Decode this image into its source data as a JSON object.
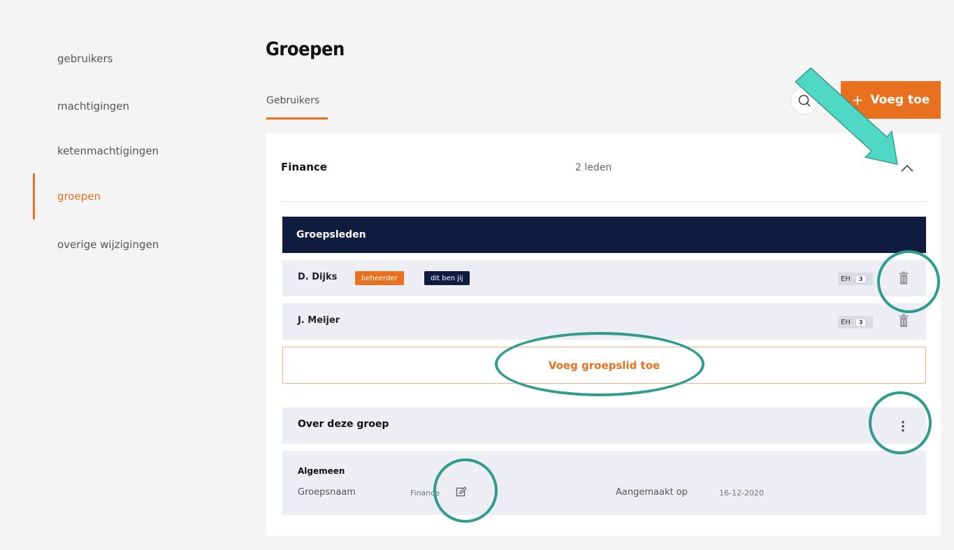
{
  "sidebar": {
    "items": [
      {
        "label": "gebruikers"
      },
      {
        "label": "machtigingen"
      },
      {
        "label": "ketenmachtigingen"
      },
      {
        "label": "groepen"
      },
      {
        "label": "overige wijzigingen"
      }
    ]
  },
  "page": {
    "title": "Groepen"
  },
  "tabs": [
    {
      "label": "Gebruikers"
    }
  ],
  "toolbar": {
    "search_icon": "search-icon",
    "add_label": "Voeg toe",
    "add_icon": "+"
  },
  "group": {
    "name": "Finance",
    "member_count": "2 leden",
    "members_header": "Groepsleden",
    "members": [
      {
        "name": "D. Dijks",
        "badge_admin": "beheerder",
        "badge_self": "dit ben jij",
        "role": "EH",
        "role_num": "3"
      },
      {
        "name": "J. Meijer",
        "role": "EH",
        "role_num": "3"
      }
    ],
    "add_member_label": "Voeg groepslid toe",
    "about_title": "Over deze groep",
    "info": {
      "section_title": "Algemeen",
      "name_label": "Groepsnaam",
      "name_value": "Finance",
      "created_label": "Aangemaakt op",
      "created_value": "16-12-2020"
    }
  },
  "colors": {
    "accent": "#e8701e",
    "navy": "#0f1c40",
    "annotation": "#2f9c8f",
    "arrow": "#4fd8c4"
  }
}
